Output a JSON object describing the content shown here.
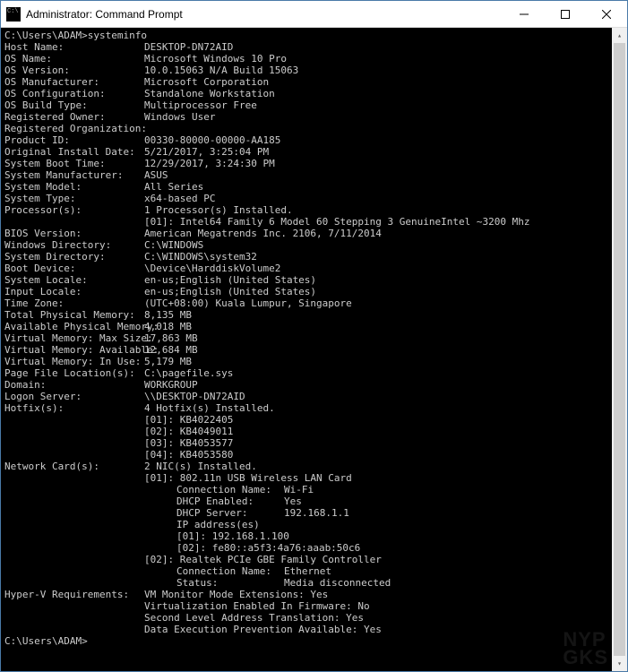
{
  "window": {
    "title": "Administrator: Command Prompt"
  },
  "terminal": {
    "prompt1": "C:\\Users\\ADAM>systeminfo",
    "prompt2": "C:\\Users\\ADAM>",
    "fields": [
      {
        "label": "Host Name:",
        "value": "DESKTOP-DN72AID"
      },
      {
        "label": "OS Name:",
        "value": "Microsoft Windows 10 Pro"
      },
      {
        "label": "OS Version:",
        "value": "10.0.15063 N/A Build 15063"
      },
      {
        "label": "OS Manufacturer:",
        "value": "Microsoft Corporation"
      },
      {
        "label": "OS Configuration:",
        "value": "Standalone Workstation"
      },
      {
        "label": "OS Build Type:",
        "value": "Multiprocessor Free"
      },
      {
        "label": "Registered Owner:",
        "value": "Windows User"
      },
      {
        "label": "Registered Organization:",
        "value": ""
      },
      {
        "label": "Product ID:",
        "value": "00330-80000-00000-AA185"
      },
      {
        "label": "Original Install Date:",
        "value": "5/21/2017, 3:25:04 PM"
      },
      {
        "label": "System Boot Time:",
        "value": "12/29/2017, 3:24:30 PM"
      },
      {
        "label": "System Manufacturer:",
        "value": "ASUS"
      },
      {
        "label": "System Model:",
        "value": "All Series"
      },
      {
        "label": "System Type:",
        "value": "x64-based PC"
      }
    ],
    "processors": {
      "label": "Processor(s):",
      "value": "1 Processor(s) Installed.",
      "items": [
        "[01]: Intel64 Family 6 Model 60 Stepping 3 GenuineIntel ~3200 Mhz"
      ]
    },
    "fields2": [
      {
        "label": "BIOS Version:",
        "value": "American Megatrends Inc. 2106, 7/11/2014"
      },
      {
        "label": "Windows Directory:",
        "value": "C:\\WINDOWS"
      },
      {
        "label": "System Directory:",
        "value": "C:\\WINDOWS\\system32"
      },
      {
        "label": "Boot Device:",
        "value": "\\Device\\HarddiskVolume2"
      },
      {
        "label": "System Locale:",
        "value": "en-us;English (United States)"
      },
      {
        "label": "Input Locale:",
        "value": "en-us;English (United States)"
      },
      {
        "label": "Time Zone:",
        "value": "(UTC+08:00) Kuala Lumpur, Singapore"
      },
      {
        "label": "Total Physical Memory:",
        "value": "8,135 MB"
      },
      {
        "label": "Available Physical Memory:",
        "value": "4,018 MB"
      },
      {
        "label": "Virtual Memory: Max Size:",
        "value": "17,863 MB"
      },
      {
        "label": "Virtual Memory: Available:",
        "value": "12,684 MB"
      },
      {
        "label": "Virtual Memory: In Use:",
        "value": "5,179 MB"
      },
      {
        "label": "Page File Location(s):",
        "value": "C:\\pagefile.sys"
      },
      {
        "label": "Domain:",
        "value": "WORKGROUP"
      },
      {
        "label": "Logon Server:",
        "value": "\\\\DESKTOP-DN72AID"
      }
    ],
    "hotfix": {
      "label": "Hotfix(s):",
      "value": "4 Hotfix(s) Installed.",
      "items": [
        "[01]: KB4022405",
        "[02]: KB4049011",
        "[03]: KB4053577",
        "[04]: KB4053580"
      ]
    },
    "network": {
      "label": "Network Card(s):",
      "value": "2 NIC(s) Installed.",
      "nics": [
        {
          "header": "[01]: 802.11n USB Wireless LAN Card",
          "props": [
            {
              "k": "Connection Name:",
              "v": "Wi-Fi"
            },
            {
              "k": "DHCP Enabled:",
              "v": "Yes"
            },
            {
              "k": "DHCP Server:",
              "v": "192.168.1.1"
            }
          ],
          "ip_label": "IP address(es)",
          "ips": [
            "[01]: 192.168.1.100",
            "[02]: fe80::a5f3:4a76:aaab:50c6"
          ]
        },
        {
          "header": "[02]: Realtek PCIe GBE Family Controller",
          "props": [
            {
              "k": "Connection Name:",
              "v": "Ethernet"
            },
            {
              "k": "Status:",
              "v": "Media disconnected"
            }
          ]
        }
      ]
    },
    "hyperv": {
      "label": "Hyper-V Requirements:",
      "items": [
        "VM Monitor Mode Extensions: Yes",
        "Virtualization Enabled In Firmware: No",
        "Second Level Address Translation: Yes",
        "Data Execution Prevention Available: Yes"
      ]
    }
  },
  "watermark": {
    "line1": "NYP",
    "line2": "GKS"
  }
}
